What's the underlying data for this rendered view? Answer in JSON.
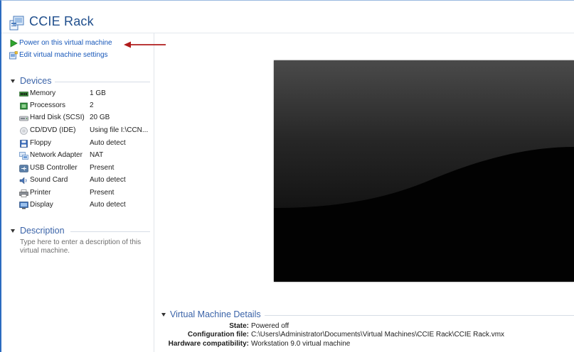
{
  "window": {
    "title": "CCIE Rack"
  },
  "actions": [
    {
      "label": "Power on this virtual machine",
      "icon": "play-icon"
    },
    {
      "label": "Edit virtual machine settings",
      "icon": "vm-settings-icon"
    }
  ],
  "devices": {
    "header": "Devices",
    "items": [
      {
        "name": "Memory",
        "value": "1 GB",
        "icon": "memory-icon"
      },
      {
        "name": "Processors",
        "value": "2",
        "icon": "processor-icon"
      },
      {
        "name": "Hard Disk (SCSI)",
        "value": "20 GB",
        "icon": "hard-disk-icon"
      },
      {
        "name": "CD/DVD (IDE)",
        "value": "Using file I:\\CCN...",
        "icon": "cd-dvd-icon"
      },
      {
        "name": "Floppy",
        "value": "Auto detect",
        "icon": "floppy-icon"
      },
      {
        "name": "Network Adapter",
        "value": "NAT",
        "icon": "network-adapter-icon"
      },
      {
        "name": "USB Controller",
        "value": "Present",
        "icon": "usb-icon"
      },
      {
        "name": "Sound Card",
        "value": "Auto detect",
        "icon": "sound-card-icon"
      },
      {
        "name": "Printer",
        "value": "Present",
        "icon": "printer-icon"
      },
      {
        "name": "Display",
        "value": "Auto detect",
        "icon": "display-icon"
      }
    ]
  },
  "description": {
    "header": "Description",
    "placeholder": "Type here to enter a description of this virtual machine."
  },
  "details": {
    "header": "Virtual Machine Details",
    "rows": [
      {
        "label": "State:",
        "value": "Powered off"
      },
      {
        "label": "Configuration file:",
        "value": "C:\\Users\\Administrator\\Documents\\Virtual Machines\\CCIE Rack\\CCIE Rack.vmx"
      },
      {
        "label": "Hardware compatibility:",
        "value": "Workstation 9.0 virtual machine"
      }
    ]
  },
  "colors": {
    "link": "#1757b9",
    "section_header": "#3a63a8",
    "annotation_arrow": "#b01c1c",
    "window_border": "#2b6bbf"
  }
}
